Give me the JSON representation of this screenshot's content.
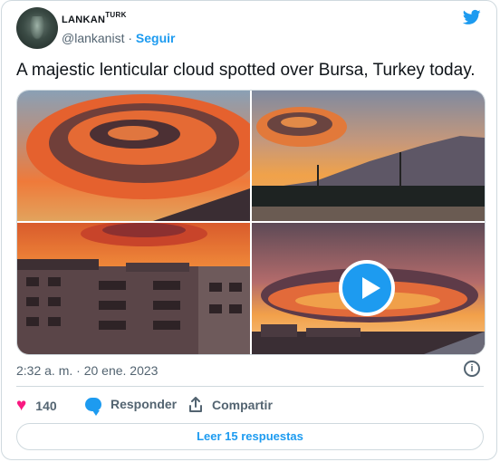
{
  "author": {
    "display_name": "LANKAN",
    "display_name_sup": "TURK",
    "handle": "@lankanist",
    "separator": "·",
    "follow_label": "Seguir"
  },
  "tweet": {
    "text": "A majestic lenticular cloud spotted over Bursa, Turkey today.",
    "timestamp": "2:32 a. m. · 20 ene. 2023"
  },
  "media": {
    "tiles": [
      {
        "icon": "photo-lenticular-cloud-closeup"
      },
      {
        "icon": "photo-cloud-over-mountains"
      },
      {
        "icon": "photo-cloud-over-buildings"
      },
      {
        "icon": "video-cloud-sunset"
      }
    ],
    "play_icon": "play-icon"
  },
  "actions": {
    "like_count": "140",
    "reply_label": "Responder",
    "share_label": "Compartir"
  },
  "read_replies_label": "Leer 15 respuestas",
  "colors": {
    "accent": "#1d9bf0",
    "like": "#f91880",
    "muted": "#536471",
    "border": "#cfd9de"
  }
}
